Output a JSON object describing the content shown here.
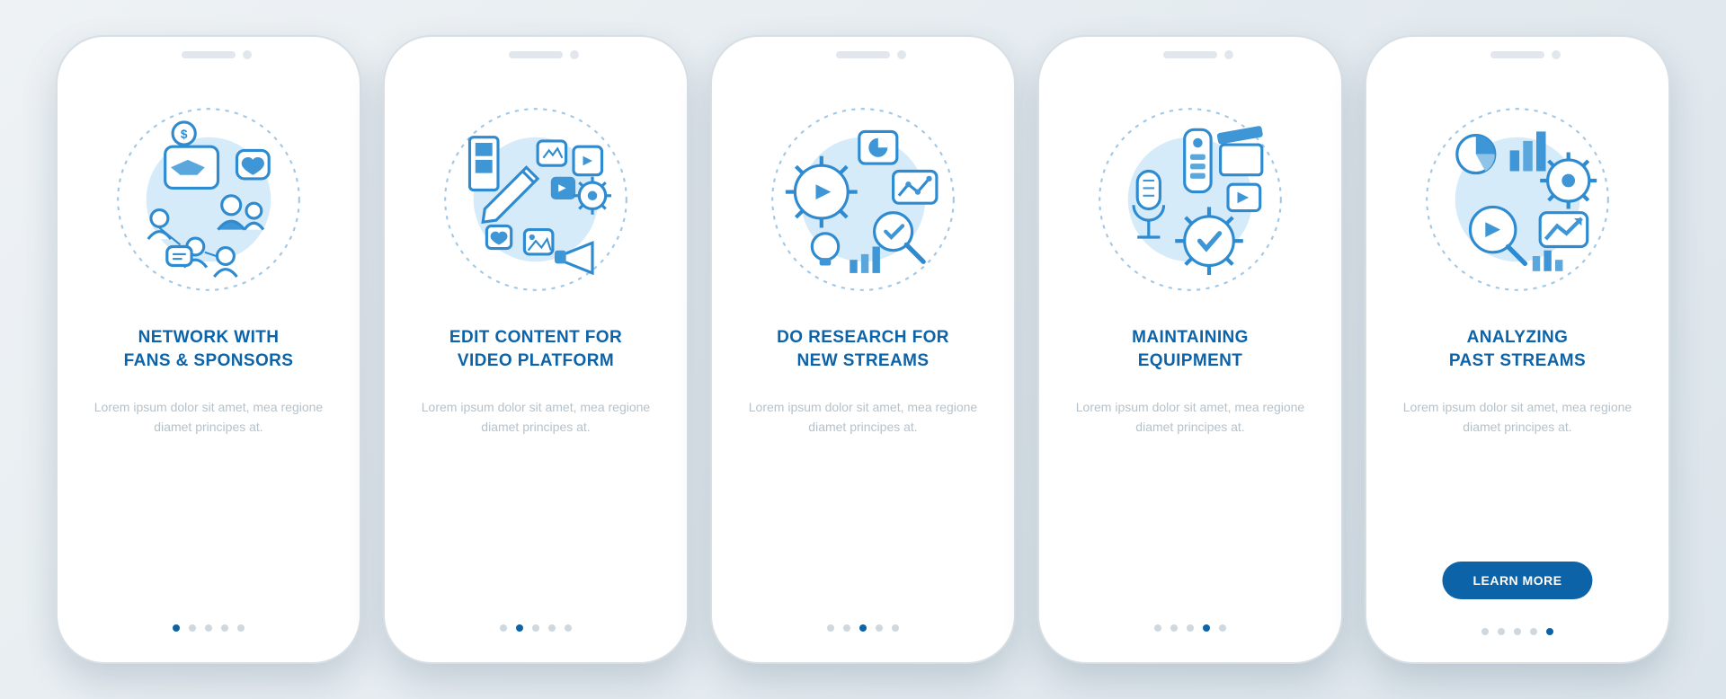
{
  "colors": {
    "primary": "#0d63a8",
    "muted": "#b5c2cc",
    "bg": "#eef2f5"
  },
  "lorem": "Lorem ipsum dolor sit amet, mea regione diamet principes at.",
  "button_label": "LEARN MORE",
  "screens": [
    {
      "title": "NETWORK WITH\nFANS & SPONSORS",
      "icon": "network-icon",
      "active_dot": 0,
      "has_button": false
    },
    {
      "title": "EDIT CONTENT FOR\nVIDEO PLATFORM",
      "icon": "edit-icon",
      "active_dot": 1,
      "has_button": false
    },
    {
      "title": "DO RESEARCH FOR\nNEW STREAMS",
      "icon": "research-icon",
      "active_dot": 2,
      "has_button": false
    },
    {
      "title": "MAINTAINING\nEQUIPMENT",
      "icon": "equipment-icon",
      "active_dot": 3,
      "has_button": false
    },
    {
      "title": "ANALYZING\nPAST STREAMS",
      "icon": "analytics-icon",
      "active_dot": 4,
      "has_button": true
    }
  ]
}
